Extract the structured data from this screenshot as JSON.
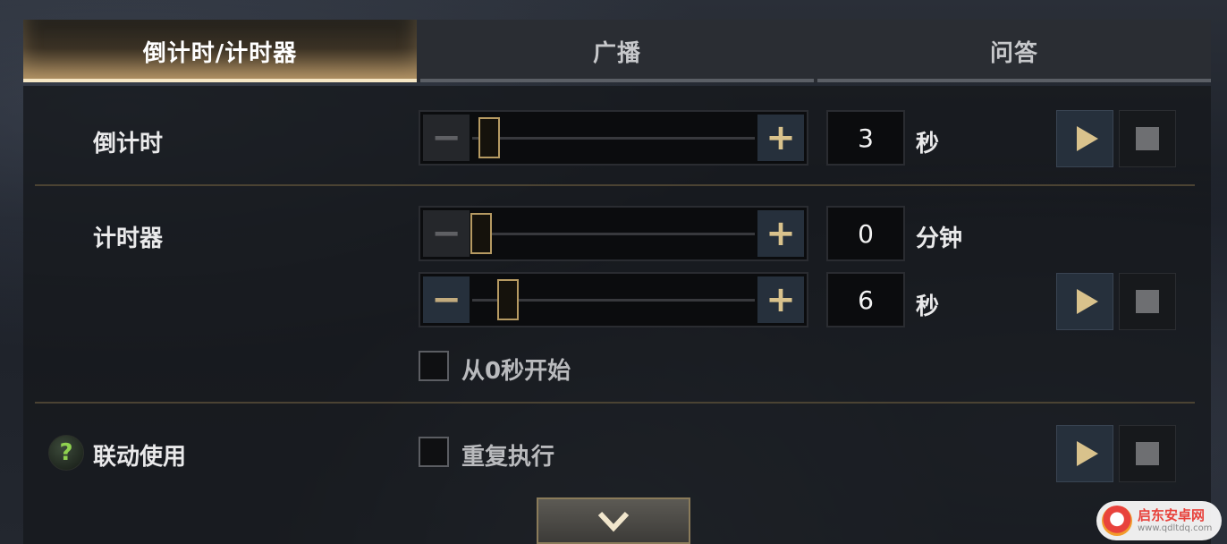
{
  "tabs": [
    {
      "label": "倒计时/计时器",
      "active": true
    },
    {
      "label": "广播",
      "active": false
    },
    {
      "label": "问答",
      "active": false
    }
  ],
  "countdown": {
    "label": "倒计时",
    "value": "3",
    "unit": "秒",
    "slider_level": 0.03
  },
  "timer": {
    "label": "计时器",
    "minutes": {
      "value": "0",
      "unit": "分钟",
      "slider_level": 0.0
    },
    "seconds": {
      "value": "6",
      "unit": "秒",
      "slider_level": 0.1
    },
    "start_from_zero_label": "从0秒开始",
    "start_from_zero_checked": false
  },
  "linked": {
    "label": "联动使用",
    "help_icon": "?",
    "repeat_label": "重复执行",
    "repeat_checked": false
  },
  "watermark": {
    "title": "启东安卓网",
    "url": "www.qdltdq.com"
  },
  "colors": {
    "accent_gold": "#d9c28c",
    "help_green": "#8fd14f",
    "button_blue": "#26303c"
  }
}
